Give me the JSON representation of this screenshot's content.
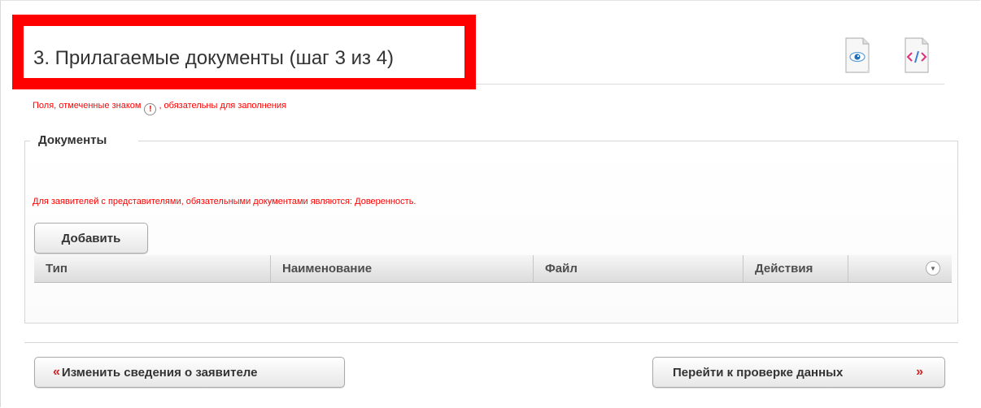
{
  "header": {
    "title": "3. Прилагаемые документы (шаг 3 из 4)",
    "view_icon": "eye-document-icon",
    "code_icon": "code-document-icon"
  },
  "required_note": {
    "before": "Поля, отмеченные знаком",
    "mark": "!",
    "after": ", обязательны для заполнения"
  },
  "documents": {
    "legend": "Документы",
    "warning": "Для заявителей с представителями, обязательными документами являются: Доверенность.",
    "add_label": "Добавить",
    "columns": [
      "Тип",
      "Наименование",
      "Файл",
      "Действия"
    ],
    "rows": []
  },
  "nav": {
    "back_arrow": "«",
    "back_label": "Изменить сведения о заявителе",
    "next_label": "Перейти к проверке данных",
    "next_arrow": "»"
  },
  "colors": {
    "highlight": "#ff0000",
    "required_text": "#ff0000",
    "arrow": "#cc2222"
  }
}
